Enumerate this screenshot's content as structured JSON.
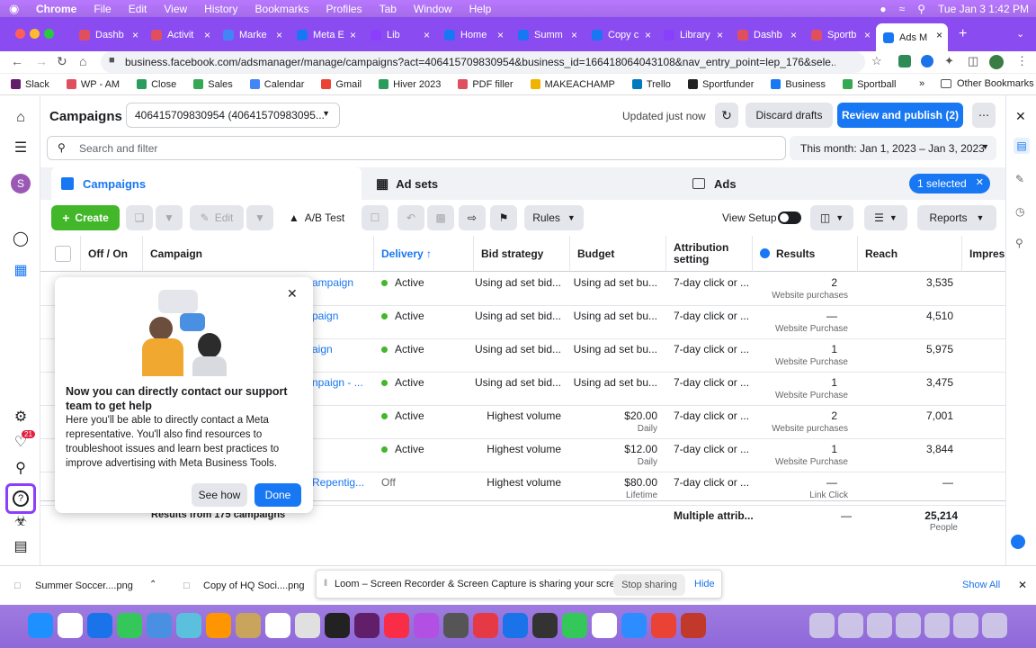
{
  "menubar": {
    "app": "Chrome",
    "items": [
      "File",
      "Edit",
      "View",
      "History",
      "Bookmarks",
      "Profiles",
      "Tab",
      "Window",
      "Help"
    ],
    "clock": "Tue Jan 3  1:42 PM"
  },
  "tabs": [
    {
      "label": "Dashb",
      "color": "#e04f5f"
    },
    {
      "label": "Activit",
      "color": "#e04f5f"
    },
    {
      "label": "Marke",
      "color": "#4285f4"
    },
    {
      "label": "Meta E",
      "color": "#1877f2"
    },
    {
      "label": "Lib",
      "color": "#8a3ffc"
    },
    {
      "label": "Home",
      "color": "#1877f2"
    },
    {
      "label": "Summ",
      "color": "#1877f2"
    },
    {
      "label": "Copy c",
      "color": "#1877f2"
    },
    {
      "label": "Library",
      "color": "#8a3ffc"
    },
    {
      "label": "Dashb",
      "color": "#e04f5f"
    },
    {
      "label": "Sportb",
      "color": "#e04f5f"
    },
    {
      "label": "Ads M",
      "color": "#1877f2"
    }
  ],
  "address": {
    "url": "business.facebook.com/adsmanager/manage/campaigns?act=406415709830954&business_id=166418064043108&nav_entry_point=lep_176&sele..."
  },
  "bookmarks": [
    {
      "label": "Slack",
      "color": "#611f69"
    },
    {
      "label": "WP - AM",
      "color": "#e04f5f"
    },
    {
      "label": "Close",
      "color": "#2a9d5c"
    },
    {
      "label": "Sales",
      "color": "#34a853"
    },
    {
      "label": "Calendar",
      "color": "#4285f4"
    },
    {
      "label": "Gmail",
      "color": "#ea4335"
    },
    {
      "label": "Hiver 2023",
      "color": "#2a9d5c"
    },
    {
      "label": "PDF filler",
      "color": "#e04f5f"
    },
    {
      "label": "MAKEACHAMP",
      "color": "#f0b400"
    },
    {
      "label": "Trello",
      "color": "#0079bf"
    },
    {
      "label": "Sportfunder",
      "color": "#222222"
    },
    {
      "label": "Business",
      "color": "#1877f2"
    },
    {
      "label": "Sportball",
      "color": "#34a853"
    }
  ],
  "bookmarks_other": "Other Bookmarks",
  "header": {
    "title": "Campaigns",
    "account": "406415709830954 (40641570983095...",
    "updated": "Updated just now",
    "discard": "Discard drafts",
    "publish": "Review and publish (2)"
  },
  "search": {
    "placeholder": "Search and filter",
    "date_range": "This month: Jan 1, 2023 – Jan 3, 2023"
  },
  "level_tabs": {
    "campaigns": "Campaigns",
    "adsets": "Ad sets",
    "ads": "Ads",
    "selected": "1 selected"
  },
  "toolbar": {
    "create": "Create",
    "edit": "Edit",
    "ab_test": "A/B Test",
    "rules": "Rules",
    "view_setup": "View Setup",
    "reports": "Reports"
  },
  "columns": [
    "Off / On",
    "Campaign",
    "Delivery ↑",
    "Bid strategy",
    "Budget",
    "Attribution setting",
    "Results",
    "Reach",
    "Impres"
  ],
  "rows": [
    {
      "campaign": "ampaign",
      "delivery": "Active",
      "bid": "Using ad set bid...",
      "budget": "Using ad set bu...",
      "budget_sub": "",
      "attribution": "7-day click or ...",
      "result": "2",
      "result_sub": "Website purchases",
      "reach": "3,535"
    },
    {
      "campaign": "paign",
      "delivery": "Active",
      "bid": "Using ad set bid...",
      "budget": "Using ad set bu...",
      "budget_sub": "",
      "attribution": "7-day click or ...",
      "result": "—",
      "result_sub": "Website Purchase",
      "reach": "4,510"
    },
    {
      "campaign": "aign",
      "delivery": "Active",
      "bid": "Using ad set bid...",
      "budget": "Using ad set bu...",
      "budget_sub": "",
      "attribution": "7-day click or ...",
      "result": "1",
      "result_sub": "Website Purchase",
      "reach": "5,975"
    },
    {
      "campaign": "npaign - ...",
      "delivery": "Active",
      "bid": "Using ad set bid...",
      "budget": "Using ad set bu...",
      "budget_sub": "",
      "attribution": "7-day click or ...",
      "result": "1",
      "result_sub": "Website Purchase",
      "reach": "3,475"
    },
    {
      "campaign": "",
      "delivery": "Active",
      "bid": "Highest volume",
      "budget": "$20.00",
      "budget_sub": "Daily",
      "attribution": "7-day click or ...",
      "result": "2",
      "result_sub": "Website purchases",
      "reach": "7,001"
    },
    {
      "campaign": "",
      "delivery": "Active",
      "bid": "Highest volume",
      "budget": "$12.00",
      "budget_sub": "Daily",
      "attribution": "7-day click or ...",
      "result": "1",
      "result_sub": "Website Purchase",
      "reach": "3,844"
    },
    {
      "campaign": "Repentig...",
      "delivery": "Off",
      "bid": "Highest volume",
      "budget": "$80.00",
      "budget_sub": "Lifetime",
      "attribution": "7-day click or ...",
      "result": "—",
      "result_sub": "Link Click",
      "reach": "—"
    }
  ],
  "totals": {
    "label": "Results from 175 campaigns",
    "attribution": "Multiple attrib...",
    "result": "—",
    "reach": "25,214",
    "reach_sub": "People"
  },
  "popup": {
    "title": "Now you can directly contact our support team to get help",
    "body": "Here you'll be able to directly contact a Meta representative. You'll also find resources to troubleshoot issues and learn best practices to improve advertising with Meta Business Tools.",
    "see_how": "See how",
    "done": "Done"
  },
  "downloads": {
    "file1": "Summer Soccer....png",
    "file2": "Copy of HQ Soci....png",
    "show_all": "Show All"
  },
  "loom": {
    "message": "Loom – Screen Recorder & Screen Capture is sharing your screen.",
    "stop": "Stop sharing",
    "hide": "Hide"
  },
  "rail": {
    "notif_count": "21",
    "avatar_letter": "S"
  },
  "colors": {
    "blue": "#1877f2",
    "green": "#42b72a",
    "tabbar": "#8a4cf0"
  }
}
